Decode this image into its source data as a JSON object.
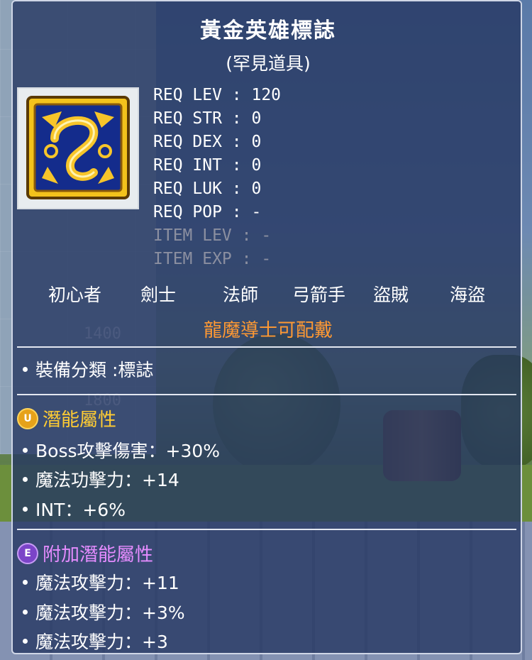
{
  "item": {
    "name": "黃金英雄標誌",
    "rarity": "(罕見道具)"
  },
  "requirements": [
    {
      "label": "REQ LEV",
      "value": "120"
    },
    {
      "label": "REQ STR",
      "value": "0"
    },
    {
      "label": "REQ DEX",
      "value": "0"
    },
    {
      "label": "REQ INT",
      "value": "0"
    },
    {
      "label": "REQ LUK",
      "value": "0"
    },
    {
      "label": "REQ POP",
      "value": "-"
    },
    {
      "label": "ITEM LEV",
      "value": "-"
    },
    {
      "label": "ITEM EXP",
      "value": "-"
    }
  ],
  "jobs": [
    "初心者",
    "劍士",
    "法師",
    "弓箭手",
    "盜賊",
    "海盜"
  ],
  "job_note": "龍魔導士可配戴",
  "category": "裝備分類 :標誌",
  "potential": {
    "badge": "U",
    "title": "潛能屬性",
    "lines": [
      "Boss攻擊傷害：+30%",
      "魔法功擊力：+14",
      "INT：+6%"
    ]
  },
  "bonus_potential": {
    "badge": "E",
    "title": "附加潛能屬性",
    "lines": [
      "魔法攻擊力：+11",
      "魔法攻擊力：+3%",
      "魔法攻擊力：+3"
    ]
  },
  "background": {
    "inventory_numbers": [
      "1400",
      "1800"
    ]
  },
  "colors": {
    "job_note": "#ff9933",
    "potential_title": "#ffcc33",
    "bonus_title": "#e58cff",
    "dim_text": "#8b8fa0"
  }
}
